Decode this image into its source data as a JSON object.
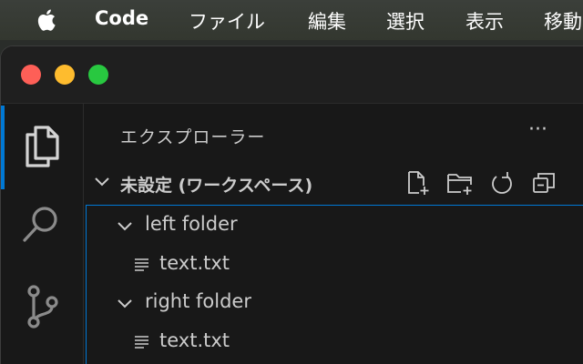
{
  "menubar": {
    "app_name": "Code",
    "items": [
      "ファイル",
      "編集",
      "選択",
      "表示",
      "移動"
    ]
  },
  "window": {
    "traffic_lights": {
      "close_color": "#fe5f57",
      "minimize_color": "#febc2e",
      "maximize_color": "#28c840"
    }
  },
  "activitybar": {
    "items": [
      {
        "icon": "files-icon",
        "active": true
      },
      {
        "icon": "search-icon",
        "active": false
      },
      {
        "icon": "source-control-icon",
        "active": false
      }
    ],
    "accent": "#0078d4"
  },
  "sidebar": {
    "title": "エクスプローラー",
    "more_label": "···",
    "section": {
      "label": "未設定 (ワークスペース)",
      "actions": [
        "new-file-icon",
        "new-folder-icon",
        "refresh-icon",
        "collapse-all-icon"
      ]
    },
    "tree": [
      {
        "type": "folder",
        "label": "left folder",
        "expanded": true
      },
      {
        "type": "file",
        "label": "text.txt"
      },
      {
        "type": "folder",
        "label": "right folder",
        "expanded": true
      },
      {
        "type": "file",
        "label": "text.txt"
      }
    ]
  }
}
